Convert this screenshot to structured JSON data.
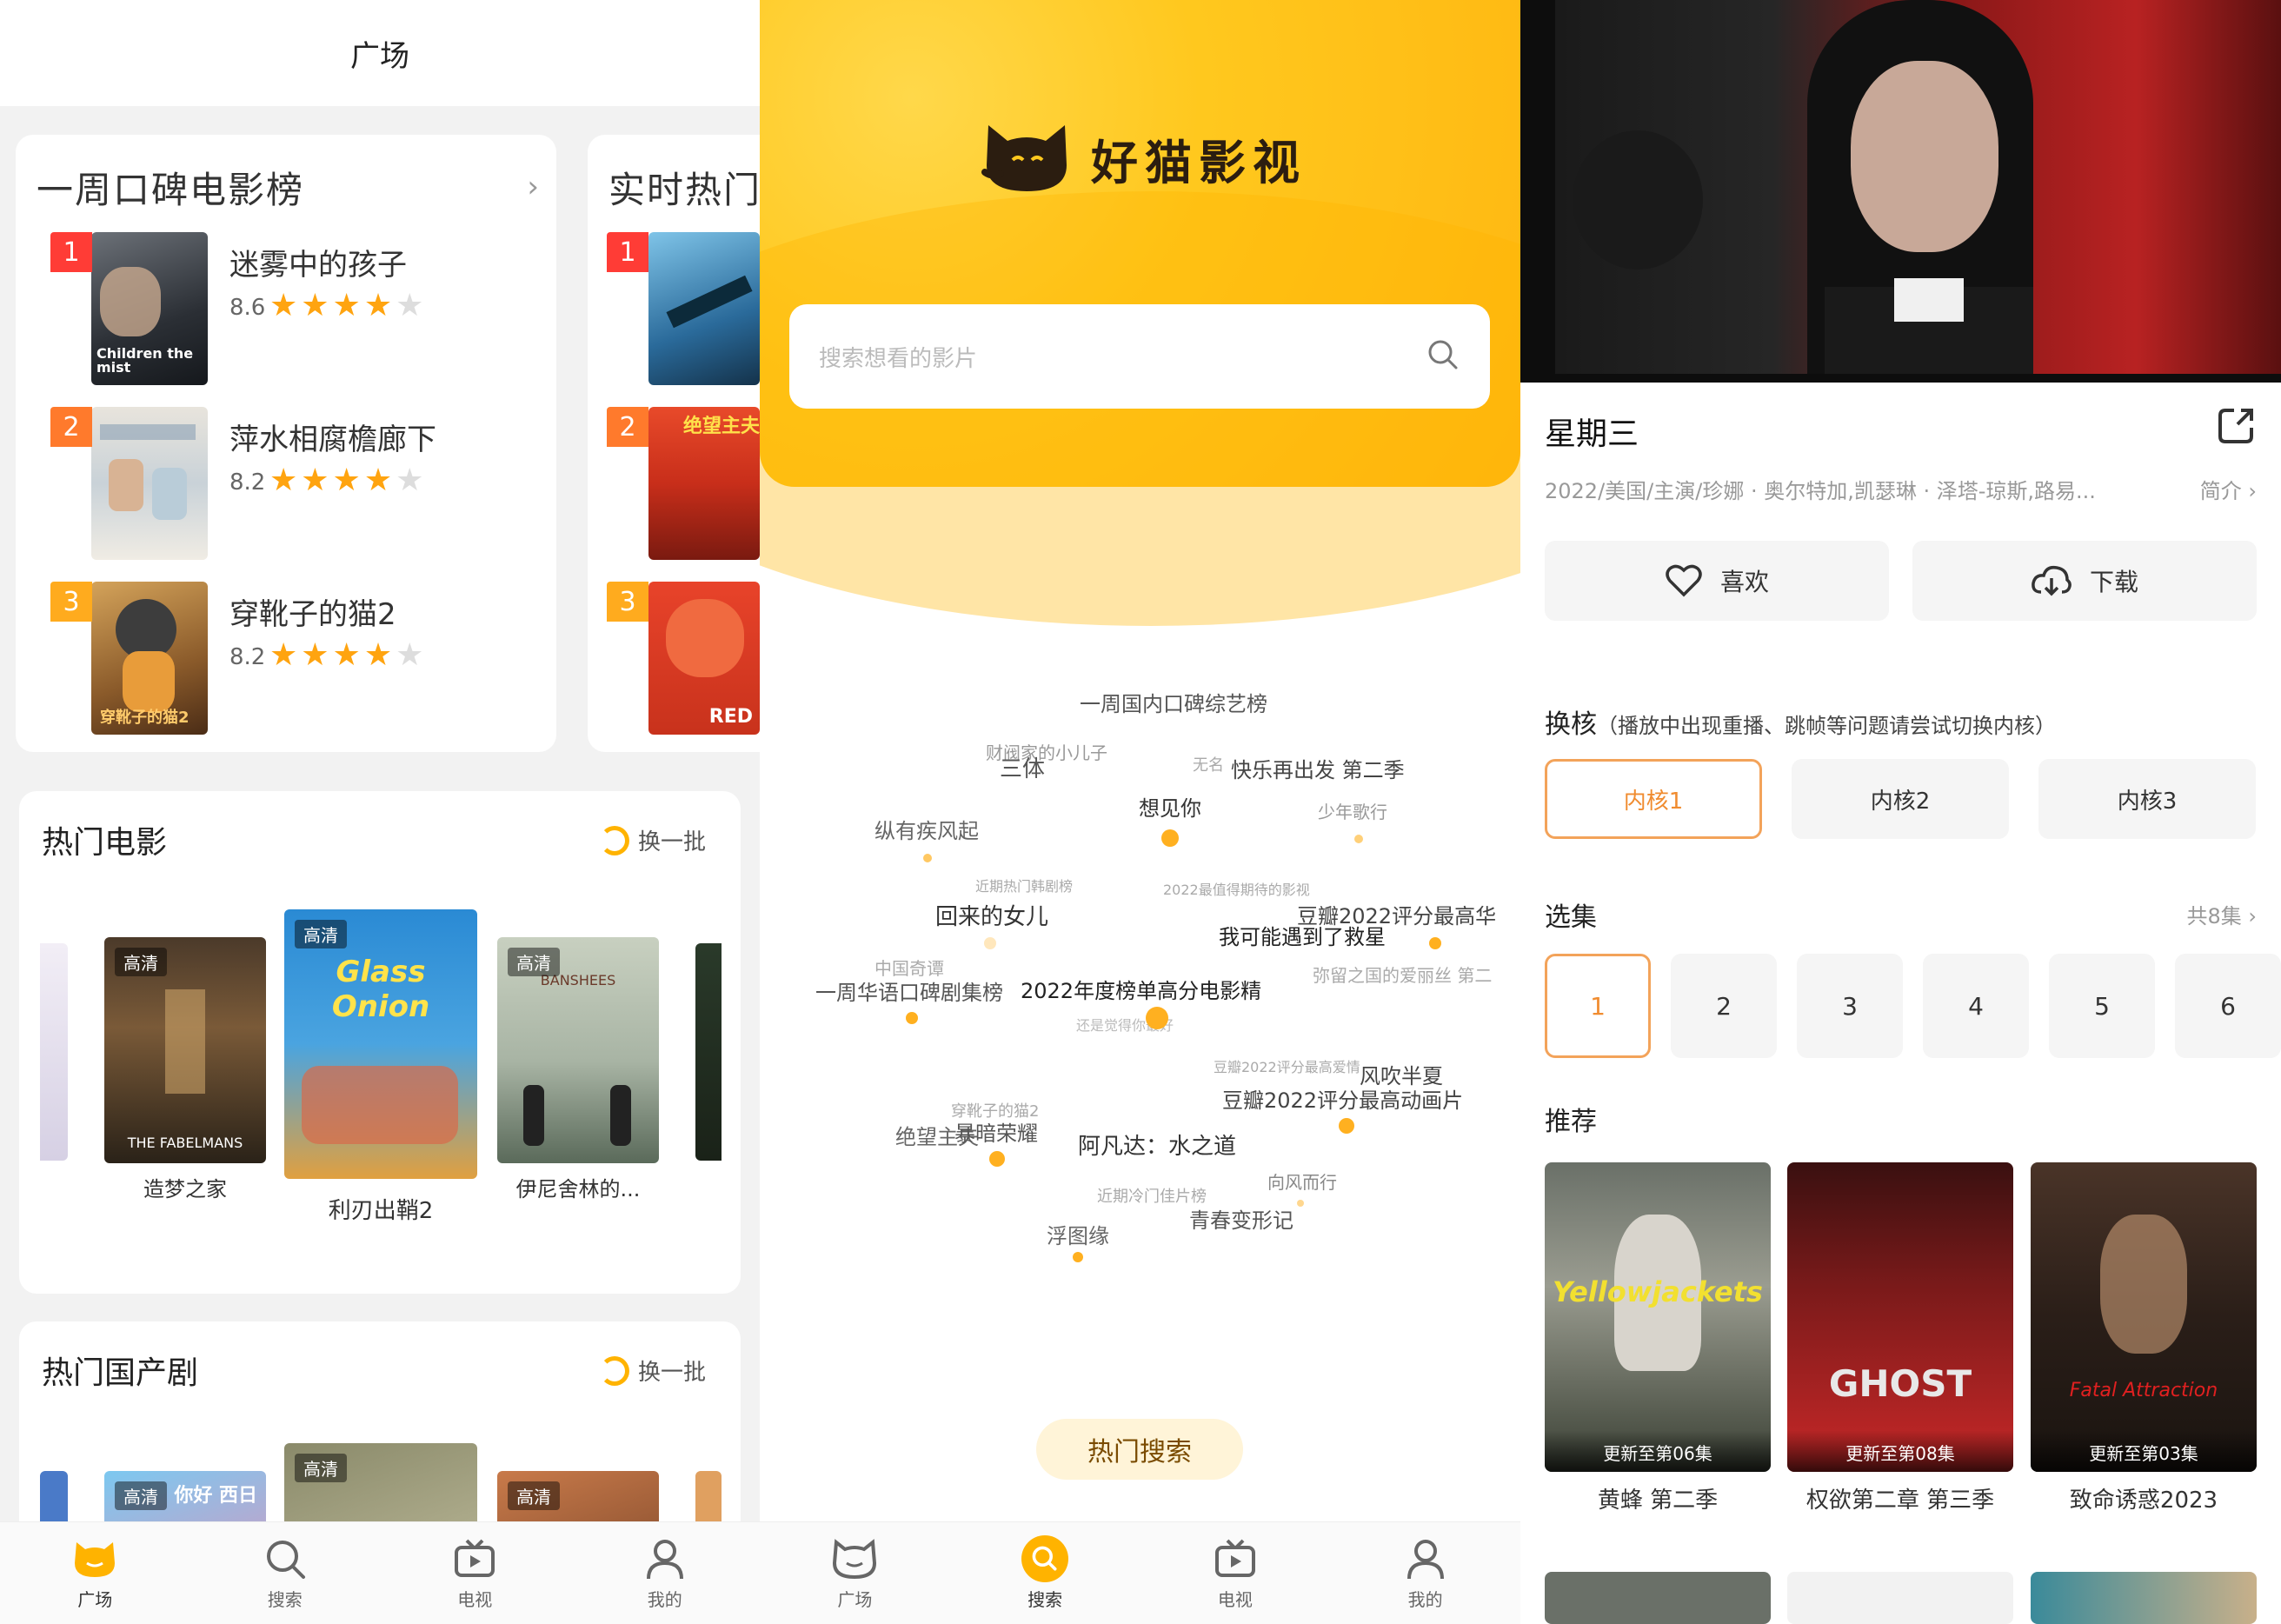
{
  "panel1": {
    "header_title": "广场",
    "weekly_card": {
      "title": "一周口碑电影榜",
      "chevron": "›",
      "items": [
        {
          "rank": "1",
          "name": "迷雾中的孩子",
          "score": "8.6",
          "poster_text": "Children the mist",
          "stars": 4
        },
        {
          "rank": "2",
          "name": "萍水相腐檐廊下",
          "score": "8.2",
          "poster_text": "",
          "stars": 4
        },
        {
          "rank": "3",
          "name": "穿靴子的猫2",
          "score": "8.2",
          "poster_text": "穿靴子的猫2",
          "stars": 4
        }
      ]
    },
    "realtime_card": {
      "title": "实时热门",
      "ranks": [
        "1",
        "2",
        "3"
      ],
      "poster_texts": [
        "",
        "绝望主夫",
        "RED"
      ]
    },
    "hot_movies": {
      "title": "热门电影",
      "refresh_label": "换一批",
      "items": [
        {
          "name": "造梦之家",
          "badge": "高清",
          "poster_text": "THE FABELMANS"
        },
        {
          "name": "利刃出鞘2",
          "badge": "高清",
          "poster_text": "Glass Onion"
        },
        {
          "name": "伊尼舍林的...",
          "badge": "高清",
          "poster_text": "BANSHEES"
        }
      ]
    },
    "hot_domestic": {
      "title": "热门国产剧",
      "refresh_label": "换一批",
      "badges": [
        "高清",
        "高清",
        "高清"
      ],
      "poster_texts": [
        "",
        "",
        "你好 西日"
      ]
    },
    "tabs": [
      "广场",
      "搜索",
      "电视",
      "我的"
    ]
  },
  "panel2": {
    "brand_name": "好猫影视",
    "search_placeholder": "搜索想看的影片",
    "cloud": {
      "w1": "一周国内口碑综艺榜",
      "w2": "财阀家的小儿子",
      "w3": "三体",
      "w4": "无名",
      "w5": "快乐再出发 第二季",
      "w6": "想见你",
      "w7": "少年歌行",
      "w8": "纵有疾风起",
      "w9": "近期热门韩剧榜",
      "w10": "2022最值得期待的影视",
      "w11": "回来的女儿",
      "w12": "豆瓣2022评分最高华",
      "w13": "我可能遇到了救星",
      "w14": "中国奇谭",
      "w15": "弥留之国的爱丽丝 第二",
      "w16": "一周华语口碑剧集榜",
      "w17": "2022年度榜单高分电影精",
      "w18": "还是觉得你最好",
      "w19": "豆瓣2022评分最高爱情",
      "w20": "风吹半夏",
      "w21": "豆瓣2022评分最高动画片",
      "w22": "穿靴子的猫2",
      "w23": "绝望主夫",
      "w24": "暴暗荣耀",
      "w25": "阿凡达：水之道",
      "w26": "向风而行",
      "w27": "近期冷门佳片榜",
      "w28": "青春变形记",
      "w29": "浮图缘"
    },
    "hot_search_label": "热门搜索",
    "tabs": [
      "广场",
      "搜索",
      "电视",
      "我的"
    ]
  },
  "panel3": {
    "title": "星期三",
    "meta": "2022/美国/主演/珍娜 · 奥尔特加,凯瑟琳 · 泽塔-琼斯,路易...",
    "intro_label": "简介 ›",
    "like_label": "喜欢",
    "download_label": "下载",
    "core_section_title": "换核",
    "core_section_hint": "（播放中出现重播、跳帧等问题请尝试切换内核）",
    "cores": [
      "内核1",
      "内核2",
      "内核3"
    ],
    "episodes_title": "选集",
    "episodes_total": "共8集 ›",
    "episodes": [
      "1",
      "2",
      "3",
      "4",
      "5",
      "6"
    ],
    "recommend_title": "推荐",
    "recommendations": [
      {
        "name": "黄蜂 第二季",
        "update": "更新至第06集",
        "poster_text": "Yellowjackets"
      },
      {
        "name": "权欲第二章 第三季",
        "update": "更新至第08集",
        "poster_text": "GHOST"
      },
      {
        "name": "致命诱惑2023",
        "update": "更新至第03集",
        "poster_text": "Fatal Attraction"
      }
    ]
  },
  "colors": {
    "accent": "#ffb300",
    "rank1": "#ff3c36",
    "rank2": "#ff7a2c",
    "rank3": "#ffab1e",
    "selected_border": "#f3a35a"
  }
}
